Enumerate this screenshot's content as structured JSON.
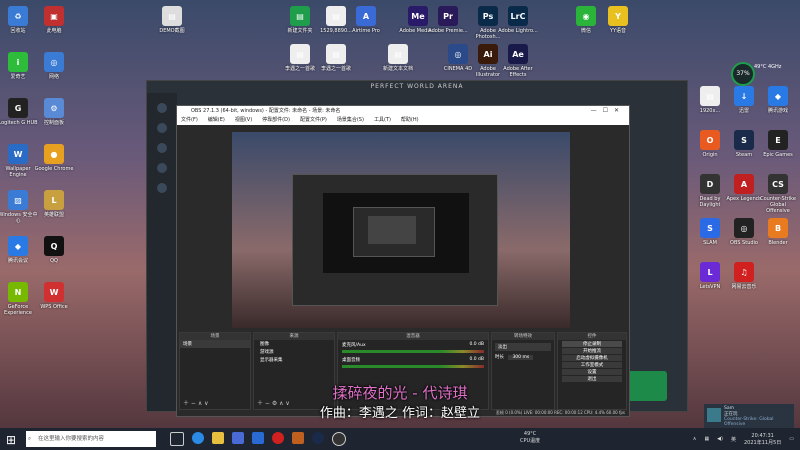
{
  "desktop": {
    "left_icons": [
      {
        "label": "回收站",
        "color": "#3a7bd5",
        "glyph": "♻"
      },
      {
        "label": "此电脑",
        "color": "#c03030",
        "glyph": "▣"
      },
      {
        "label": "爱奇艺",
        "color": "#2ebd3b",
        "glyph": "i"
      },
      {
        "label": "网络",
        "color": "#3a7bd5",
        "glyph": "◎"
      },
      {
        "label": "Logitech G HUB",
        "color": "#222",
        "glyph": "G"
      },
      {
        "label": "控制面板",
        "color": "#5a8ad5",
        "glyph": "⚙"
      },
      {
        "label": "Wallpaper Engine",
        "color": "#2a6bc5",
        "glyph": "W"
      },
      {
        "label": "Google Chrome",
        "color": "#e8a020",
        "glyph": "●"
      },
      {
        "label": "Windows 安全中心",
        "color": "#3a7bd5",
        "glyph": "▨"
      },
      {
        "label": "英雄联盟",
        "color": "#c8a040",
        "glyph": "L"
      },
      {
        "label": "腾讯会议",
        "color": "#2a7ae5",
        "glyph": "◆"
      },
      {
        "label": "QQ",
        "color": "#111",
        "glyph": "Q"
      },
      {
        "label": "GeForce Experience",
        "color": "#76b900",
        "glyph": "N"
      },
      {
        "label": "WPS Office",
        "color": "#d03030",
        "glyph": "W"
      }
    ],
    "top_icons": [
      {
        "label": "DEMO截图",
        "color": "#ddd",
        "glyph": "▤"
      },
      {
        "label": "新建文件夹",
        "color": "#1e9e4a",
        "glyph": "▤"
      },
      {
        "label": "1529,8890...",
        "color": "#eee",
        "glyph": "▤"
      },
      {
        "label": "Airtime Pro",
        "color": "#3a6ad5",
        "glyph": "A"
      },
      {
        "label": "Adobe Media...",
        "color": "#2a1a6a",
        "glyph": "Me"
      },
      {
        "label": "Adobe Premie...",
        "color": "#2a1a5a",
        "glyph": "Pr"
      },
      {
        "label": "Adobe Photosh...",
        "color": "#0a2a4a",
        "glyph": "Ps"
      },
      {
        "label": "Adobe Lightro...",
        "color": "#0a2a4a",
        "glyph": "LrC"
      },
      {
        "label": "微信",
        "color": "#2ab53a",
        "glyph": "◉"
      },
      {
        "label": "YY语音",
        "color": "#e8c020",
        "glyph": "Y"
      }
    ],
    "top_icons_row2": [
      {
        "label": "李遇之一首歌",
        "color": "#eee",
        "glyph": "▤"
      },
      {
        "label": "李遇之一首歌",
        "color": "#eee",
        "glyph": "▤"
      },
      {
        "label": "新建文本文档",
        "color": "#eee",
        "glyph": "▤"
      },
      {
        "label": "CINEMA 4D",
        "color": "#2a4a8a",
        "glyph": "◎"
      },
      {
        "label": "Adobe Illustrator",
        "color": "#3a1a0a",
        "glyph": "Ai"
      },
      {
        "label": "Adobe After Effects",
        "color": "#1a1a4a",
        "glyph": "Ae"
      }
    ],
    "right_icons": [
      {
        "label": "1920x...",
        "color": "#eee",
        "glyph": "▤"
      },
      {
        "label": "迅雷",
        "color": "#2a7ae5",
        "glyph": "↓"
      },
      {
        "label": "腾讯游戏",
        "color": "#2a7ae5",
        "glyph": "◆"
      },
      {
        "label": "Origin",
        "color": "#e85a20",
        "glyph": "O"
      },
      {
        "label": "Steam",
        "color": "#1a2a4a",
        "glyph": "S"
      },
      {
        "label": "Epic Games",
        "color": "#222",
        "glyph": "E"
      },
      {
        "label": "Dead by Daylight",
        "color": "#333",
        "glyph": "D"
      },
      {
        "label": "Apex Legends",
        "color": "#c02020",
        "glyph": "A"
      },
      {
        "label": "Counter-Strike Global Offensive",
        "color": "#333",
        "glyph": "CS"
      },
      {
        "label": "SLAM",
        "color": "#2a6ae5",
        "glyph": "S"
      },
      {
        "label": "OBS Studio",
        "color": "#222",
        "glyph": "◎"
      },
      {
        "label": "Blender",
        "color": "#e87a20",
        "glyph": "B"
      },
      {
        "label": "LetsVPN",
        "color": "#6a2ad5",
        "glyph": "L"
      },
      {
        "label": "网易云音乐",
        "color": "#d02020",
        "glyph": "♫"
      }
    ],
    "perf_badge": "37%",
    "perf_temp": "49°C 4GHz"
  },
  "game_window": {
    "title": "PERFECT WORLD ARENA"
  },
  "obs": {
    "title": "OBS 27.1.3 (64-bit, windows) - 配置文件: 未命名 - 场景: 未命名",
    "menu": [
      "文件(F)",
      "编辑(E)",
      "视图(V)",
      "停靠部件(D)",
      "配置文件(P)",
      "场景集合(S)",
      "工具(T)",
      "帮助(H)"
    ],
    "docks": {
      "scenes": {
        "title": "场景",
        "items": [
          "场景"
        ]
      },
      "sources": {
        "title": "来源",
        "items": [
          "图像",
          "游戏源",
          "显示器采集"
        ]
      },
      "mixer": {
        "title": "混音器",
        "tracks": [
          {
            "name": "麦克风/Aux",
            "level": "0.0 dB"
          },
          {
            "name": "桌面音频",
            "level": "0.0 dB"
          }
        ]
      },
      "transitions": {
        "title": "转场特效",
        "type": "淡出",
        "duration_label": "时长",
        "duration": "300 ms"
      },
      "controls": {
        "title": "控件",
        "buttons": [
          "停止录制",
          "开始推流",
          "启动虚拟摄像机",
          "工作室模式",
          "设置",
          "退出"
        ]
      }
    },
    "status": "丢帧 0 (0.0%)  LIVE: 00:00:00  REC: 00:00:12  CPU: 4.4%  60.00 fps"
  },
  "subtitle": {
    "line1": "揉碎夜的光 - 代诗琪",
    "line2": "作曲：李遇之 作词：赵壁立"
  },
  "taskbar": {
    "search_placeholder": "在这里输入你要搜索的内容",
    "weather": "49°C",
    "weather_desc": "CPU温度",
    "time": "20:47:31",
    "date": "2021年11月5日",
    "lang": "英",
    "notification": {
      "title": "Sam",
      "sub": "正在玩",
      "game": "Counter-Strike: Global Offensive"
    }
  }
}
